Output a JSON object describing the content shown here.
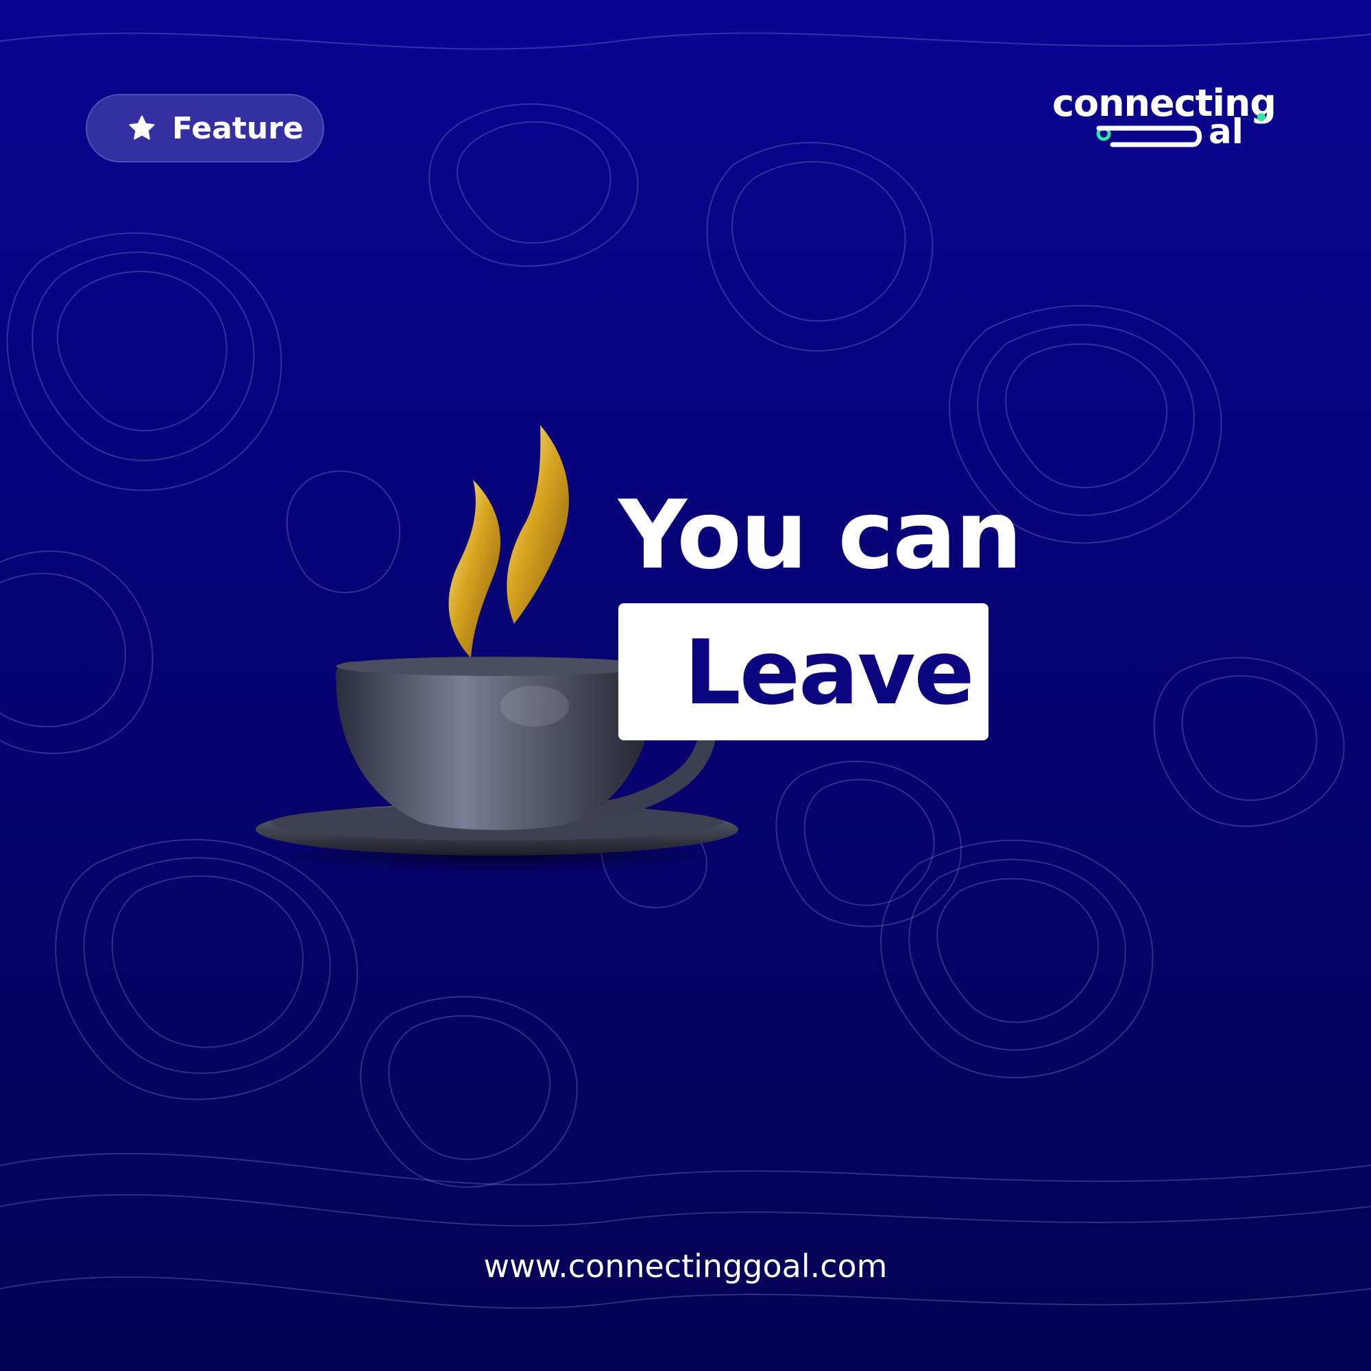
{
  "badge": {
    "label": "Feature",
    "icon": "star-icon"
  },
  "logo": {
    "line1": "connecting",
    "line2": "al",
    "accent_color": "#2ee6a8"
  },
  "headline": {
    "line1": "You can",
    "highlight": "Leave"
  },
  "footer": {
    "website": "www.connectinggoal.com"
  },
  "colors": {
    "background": "#08037a",
    "highlight_bg": "#ffffff",
    "highlight_text": "#0b0680",
    "steam": "#d4a41c"
  }
}
